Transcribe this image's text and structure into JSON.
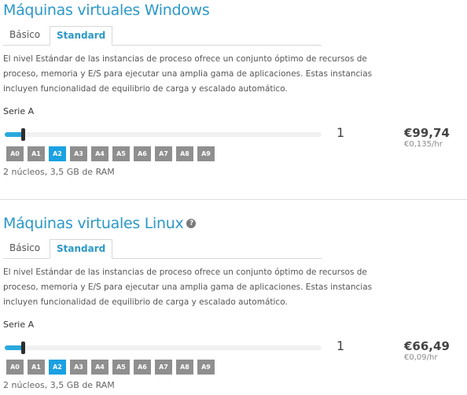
{
  "colors": {
    "accent": "#2b98c8",
    "selected_size": "#1ba1e2",
    "size_tile": "#8f8f8f"
  },
  "windows": {
    "title": "Máquinas virtuales Windows",
    "tabs": [
      {
        "label": "Básico"
      },
      {
        "label": "Standard",
        "active": true
      }
    ],
    "description": [
      "El nivel Estándar de las instancias de proceso ofrece un conjunto óptimo de recursos de",
      "proceso, memoria y E/S para ejecutar una amplia gama de aplicaciones. Estas instancias",
      "incluyen funcionalidad de equilibrio de carga y escalado automático."
    ],
    "series_label": "Serie A",
    "slider_level": 0.05,
    "sizes": [
      "A0",
      "A1",
      "A2",
      "A3",
      "A4",
      "A5",
      "A6",
      "A7",
      "A8",
      "A9"
    ],
    "selected_size": "A2",
    "spec": "2 núcleos, 3,5 GB de RAM",
    "quantity": "1",
    "price": "€99,74",
    "rate": "€0,135/hr"
  },
  "linux": {
    "title": "Máquinas virtuales Linux",
    "help_icon": "question-circle-icon",
    "help_glyph": "?",
    "tabs": [
      {
        "label": "Básico"
      },
      {
        "label": "Standard",
        "active": true
      }
    ],
    "description": [
      "El nivel Estándar de las instancias de proceso ofrece un conjunto óptimo de recursos de",
      "proceso, memoria y E/S para ejecutar una amplia gama de aplicaciones. Estas instancias",
      "incluyen funcionalidad de equilibrio de carga y escalado automático."
    ],
    "series_label": "Serie A",
    "slider_level": 0.05,
    "sizes": [
      "A0",
      "A1",
      "A2",
      "A3",
      "A4",
      "A5",
      "A6",
      "A7",
      "A8",
      "A9"
    ],
    "selected_size": "A2",
    "spec": "2 núcleos, 3,5 GB de RAM",
    "quantity": "1",
    "price": "€66,49",
    "rate": "€0,09/hr"
  }
}
